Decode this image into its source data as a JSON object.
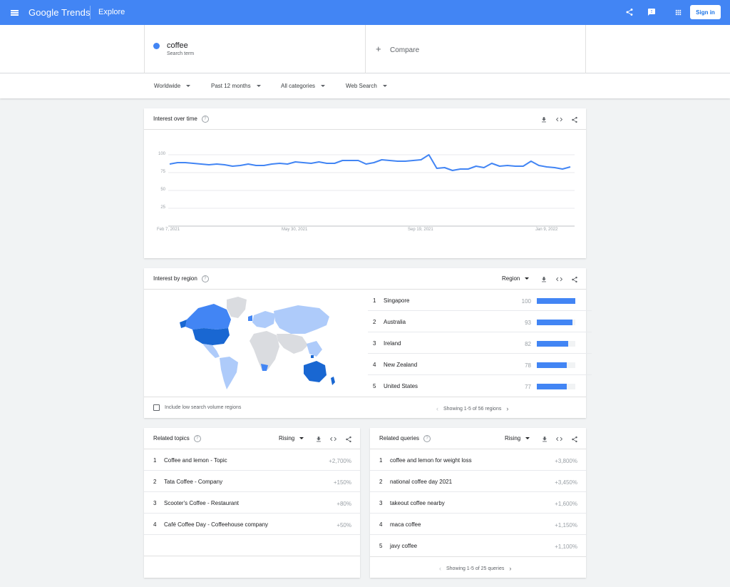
{
  "header": {
    "logo_google": "Google",
    "logo_trends": "Trends",
    "section": "Explore",
    "signin_label": "Sign in"
  },
  "search": {
    "term": "coffee",
    "term_type": "Search term",
    "compare_label": "Compare",
    "term_color": "#4285f4"
  },
  "filters": {
    "region": "Worldwide",
    "time": "Past 12 months",
    "category": "All categories",
    "property": "Web Search"
  },
  "interest_over_time": {
    "title": "Interest over time",
    "chart_data": {
      "type": "line",
      "series": [
        {
          "values": [
            87,
            89,
            89,
            88,
            87,
            86,
            87,
            86,
            84,
            85,
            87,
            85,
            85,
            87,
            88,
            87,
            90,
            89,
            88,
            90,
            88,
            88,
            92,
            92,
            92,
            87,
            89,
            93,
            92,
            91,
            91,
            92,
            93,
            100,
            81,
            82,
            78,
            80,
            80,
            84,
            82,
            88,
            84,
            85,
            84,
            84,
            91,
            85,
            83,
            82,
            80,
            83
          ]
        }
      ],
      "yticks": [
        "100",
        "75",
        "50",
        "25"
      ],
      "ylim": [
        0,
        100
      ],
      "xticks": [
        "Feb 7, 2021",
        "May 30, 2021",
        "Sep 19, 2021",
        "Jan 9, 2022"
      ],
      "color": "#4285f4"
    }
  },
  "interest_by_region": {
    "title": "Interest by region",
    "selector": "Region",
    "rows": [
      {
        "rank": "1",
        "name": "Singapore",
        "value": 100
      },
      {
        "rank": "2",
        "name": "Australia",
        "value": 93
      },
      {
        "rank": "3",
        "name": "Ireland",
        "value": 82
      },
      {
        "rank": "4",
        "name": "New Zealand",
        "value": 78
      },
      {
        "rank": "5",
        "name": "United States",
        "value": 77
      }
    ],
    "checkbox_label": "Include low search volume regions",
    "pager_text": "Showing 1-5 of 56 regions"
  },
  "related_topics": {
    "title": "Related topics",
    "selector": "Rising",
    "rows": [
      {
        "rank": "1",
        "name": "Coffee and lemon - Topic",
        "value": "+2,700%"
      },
      {
        "rank": "2",
        "name": "Tata Coffee - Company",
        "value": "+150%"
      },
      {
        "rank": "3",
        "name": "Scooter's Coffee - Restaurant",
        "value": "+80%"
      },
      {
        "rank": "4",
        "name": "Café Coffee Day - Coffeehouse company",
        "value": "+50%"
      }
    ]
  },
  "related_queries": {
    "title": "Related queries",
    "selector": "Rising",
    "rows": [
      {
        "rank": "1",
        "name": "coffee and lemon for weight loss",
        "value": "+3,800%"
      },
      {
        "rank": "2",
        "name": "national coffee day 2021",
        "value": "+3,450%"
      },
      {
        "rank": "3",
        "name": "takeout coffee nearby",
        "value": "+1,600%"
      },
      {
        "rank": "4",
        "name": "maca coffee",
        "value": "+1,150%"
      },
      {
        "rank": "5",
        "name": "javy coffee",
        "value": "+1,100%"
      }
    ],
    "pager_text": "Showing 1-5 of 25 queries"
  }
}
